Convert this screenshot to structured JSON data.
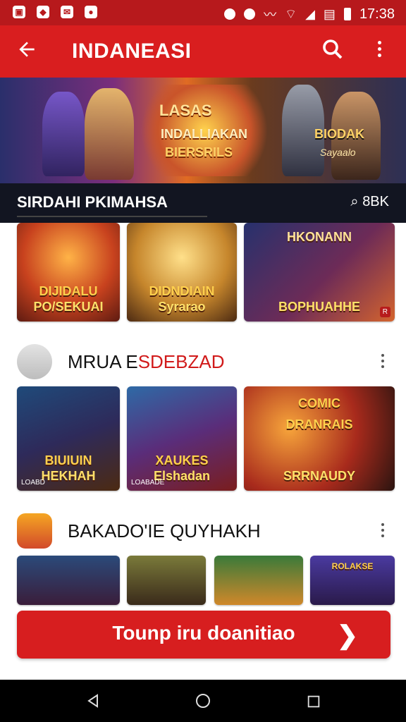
{
  "status_bar": {
    "left_icons": [
      "image-icon",
      "location-icon",
      "mail-icon",
      "record-icon"
    ],
    "time": "17:38",
    "right_icons": [
      "record-icon",
      "data-icon",
      "vibrate-icon",
      "wifi-icon",
      "signal-icon",
      "photo-icon",
      "battery-icon"
    ]
  },
  "app_bar": {
    "title": "INDANEASI",
    "back_icon": "back-arrow-icon",
    "search_icon": "search-icon",
    "more_icon": "more-vert-icon"
  },
  "hero": {
    "badge_text": "LASAS",
    "title_line1": "INDALLIAKAN",
    "title_line2": "BIERSRILS",
    "right_title": "BIODAK",
    "right_sub": "Sayaalo"
  },
  "banner_strip": {
    "title": "SIRDAHI PKIMAHSA",
    "right_label": "8BK",
    "right_icon": "search-icon"
  },
  "row1": [
    {
      "caption_top": "DIJIDALU",
      "caption": "PO/SEKUAI"
    },
    {
      "caption_top": "DIDNDIAIN",
      "caption": "Syrarao"
    },
    {
      "caption_top": "HKONANN",
      "caption": "BOPHUAHHE",
      "badge": "R"
    }
  ],
  "section2": {
    "title": "MRUA ESDEBZAD",
    "title_part1": "MRUA E",
    "title_part2": "SDEBZAD",
    "tiles": [
      {
        "caption_top": "BIUIUIN",
        "caption": "HEKHAH",
        "corner": "LOABD"
      },
      {
        "caption_top": "XAUKES",
        "caption": "Elshadan",
        "corner": "LOABADE"
      },
      {
        "caption_top": "DRANRAIS",
        "caption": "SRRNAUDY",
        "corner": "COMIC"
      }
    ]
  },
  "section3": {
    "title": "BAKADO'IE QUYHAKH",
    "tiles": [
      {
        "caption": ""
      },
      {
        "caption": ""
      },
      {
        "caption": ""
      },
      {
        "caption": "ROLAKSE"
      }
    ]
  },
  "cta": {
    "label": "Tounp iru doanitiao",
    "arrow_icon": "chevron-right-icon"
  },
  "navbar": {
    "back_icon": "nav-back-icon",
    "home_icon": "nav-home-icon",
    "recents_icon": "nav-recents-icon"
  }
}
